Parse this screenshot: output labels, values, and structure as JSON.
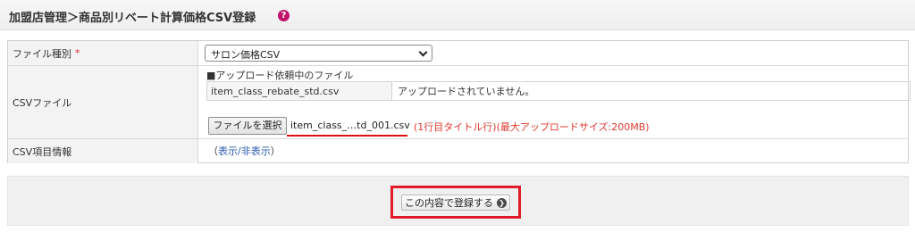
{
  "header": {
    "title": "加盟店管理＞商品別リベート計算価格CSV登録",
    "help_icon": "?"
  },
  "form": {
    "file_type": {
      "label": "ファイル種別",
      "required_mark": "*",
      "selected": "サロン価格CSV"
    },
    "csv_file": {
      "label": "CSVファイル",
      "pending_heading": "■アップロード依頼中のファイル",
      "pending_filename": "item_class_rebate_std.csv",
      "pending_status": "アップロードされていません。",
      "choose_button": "ファイルを選択",
      "chosen_file": "item_class_…td_001.csv",
      "note": "(1行目タイトル行)(最大アップロードサイズ:200MB)"
    },
    "csv_info": {
      "label": "CSV項目情報",
      "open_paren": "（",
      "toggle_link": "表示/非表示",
      "close_paren": "）"
    }
  },
  "footer": {
    "submit_label": "この内容で登録する",
    "submit_icon": "❯"
  },
  "colors": {
    "highlight": "#e21b2b",
    "note": "#e03a2f",
    "link": "#2a5db0",
    "help": "#c0126a"
  }
}
